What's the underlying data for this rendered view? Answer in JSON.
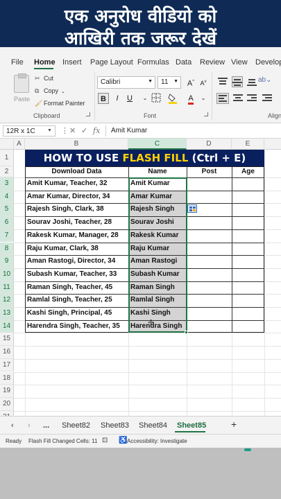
{
  "banner": {
    "line1": "एक अनुरोध वीडियो को",
    "line2": "आखिरी तक जरूर देखें"
  },
  "ribbon": {
    "tabs": [
      "File",
      "Home",
      "Insert",
      "Page Layout",
      "Formulas",
      "Data",
      "Review",
      "View",
      "Develop"
    ],
    "active_tab": "Home",
    "clipboard": {
      "paste": "Paste",
      "cut": "Cut",
      "copy": "Copy",
      "format_painter": "Format Painter",
      "label": "Clipboard"
    },
    "font": {
      "name": "Calibri",
      "size": "11",
      "label": "Font",
      "bold": "B",
      "italic": "I",
      "underline": "U",
      "font_color": "A"
    },
    "alignment": {
      "label": "Align"
    }
  },
  "formula_bar": {
    "name_box": "12R x 1C",
    "fx": "fx",
    "value": "Amit Kumar"
  },
  "sheet": {
    "columns": [
      "A",
      "B",
      "C",
      "D",
      "E"
    ],
    "selected_column": "C",
    "rows": [
      "1",
      "2",
      "3",
      "4",
      "5",
      "6",
      "7",
      "8",
      "9",
      "10",
      "11",
      "12",
      "13",
      "14",
      "15",
      "16",
      "17",
      "18",
      "19",
      "20",
      "21"
    ],
    "title_part1": "HOW TO USE ",
    "title_part2": "FLASH FILL",
    "title_part3": " (Ctrl + E)",
    "headers": [
      "Download Data",
      "Name",
      "Post",
      "Age"
    ],
    "data": [
      [
        "Amit Kumar, Teacher, 32",
        "Amit Kumar"
      ],
      [
        "Amar Kumar, Director, 34",
        "Amar Kumar"
      ],
      [
        "Rajesh Singh, Clark, 38",
        "Rajesh Singh"
      ],
      [
        "Sourav Joshi, Teacher, 28",
        "Sourav Joshi"
      ],
      [
        "Rakesk Kumar, Manager, 28",
        "Rakesk Kumar"
      ],
      [
        "Raju Kumar, Clark, 38",
        "Raju Kumar"
      ],
      [
        "Aman Rastogi, Director, 34",
        "Aman Rastogi"
      ],
      [
        "Subash Kumar, Teacher, 33",
        "Subash Kumar"
      ],
      [
        "Raman Singh, Teacher, 45",
        "Raman Singh"
      ],
      [
        "Ramlal Singh, Teacher, 25",
        "Ramlal Singh"
      ],
      [
        "Kashi Singh, Principal, 45",
        "Kashi Singh"
      ],
      [
        "Harendra Singh, Teacher, 35",
        "Harendra Singh"
      ]
    ]
  },
  "sheet_tabs": {
    "items": [
      "Sheet82",
      "Sheet83",
      "Sheet84",
      "Sheet85"
    ],
    "active": "Sheet85",
    "add": "+",
    "more": "..."
  },
  "status_bar": {
    "ready": "Ready",
    "flash_fill": "Flash Fill Changed Cells: 11",
    "accessibility": "Accessibility: Investigate"
  },
  "colors": {
    "excel_green": "#217346",
    "title_bg": "#0a1f5e",
    "highlight": "#ffd200",
    "banner_bg": "#0f2a55"
  }
}
